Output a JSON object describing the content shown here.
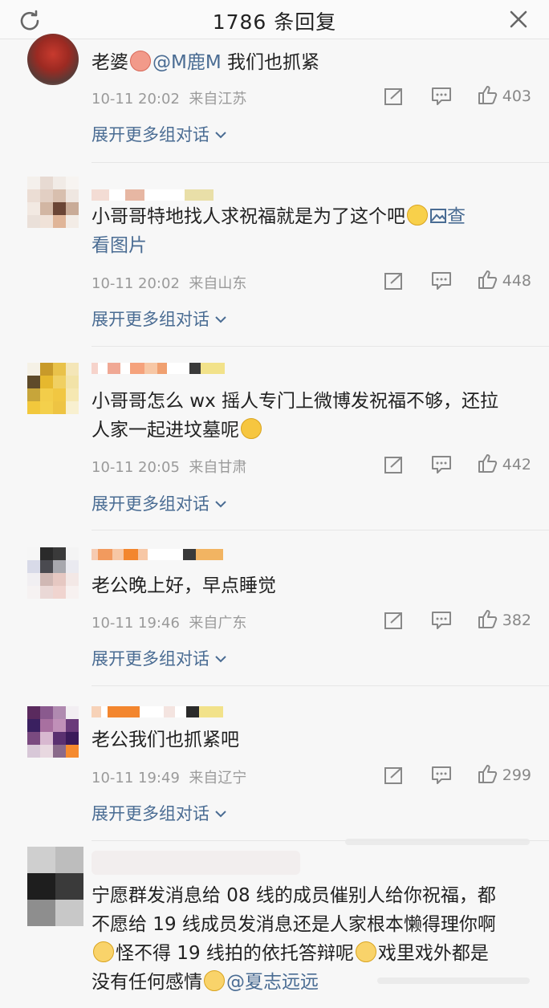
{
  "header": {
    "title": "1786 条回复"
  },
  "comments": [
    {
      "text_prefix": "老婆",
      "mention": "@M鹿M",
      "text_suffix": " 我们也抓紧",
      "time": "10-11 20:02",
      "location": "来自江苏",
      "likes": "403",
      "expand": "展开更多组对话"
    },
    {
      "text_line1": "小哥哥特地找人求祝福就是为了这个吧",
      "link_a": "查",
      "link_b": "看图片",
      "time": "10-11 20:02",
      "location": "来自山东",
      "likes": "448",
      "expand": "展开更多组对话"
    },
    {
      "text_line1": "小哥哥怎么 wx 摇人专门上微博发祝福不够，还拉",
      "text_line2": "人家一起进坟墓呢",
      "time": "10-11 20:05",
      "location": "来自甘肃",
      "likes": "442",
      "expand": "展开更多组对话"
    },
    {
      "text_line1": "老公晚上好，早点睡觉",
      "time": "10-11 19:46",
      "location": "来自广东",
      "likes": "382",
      "expand": "展开更多组对话"
    },
    {
      "text_line1": "老公我们也抓紧吧",
      "time": "10-11 19:49",
      "location": "来自辽宁",
      "likes": "299",
      "expand": "展开更多组对话"
    },
    {
      "text_line1": "宁愿群发消息给 08 线的成员催别人给你祝福，都",
      "text_line2": "不愿给 19 线成员发消息还是人家根本懒得理你啊",
      "text_line3a": "怪不得 19 线拍的依托答辩呢",
      "text_line3b": "戏里戏外都是",
      "text_line4a": "没有任何感情",
      "mention": "@夏志远远"
    }
  ],
  "colors": {
    "link": "#4a6c93",
    "meta": "#9a9a9a"
  },
  "icons": [
    "refresh-icon",
    "close-icon",
    "share-icon",
    "reply-icon",
    "like-icon",
    "chevron-down-icon",
    "image-icon"
  ]
}
